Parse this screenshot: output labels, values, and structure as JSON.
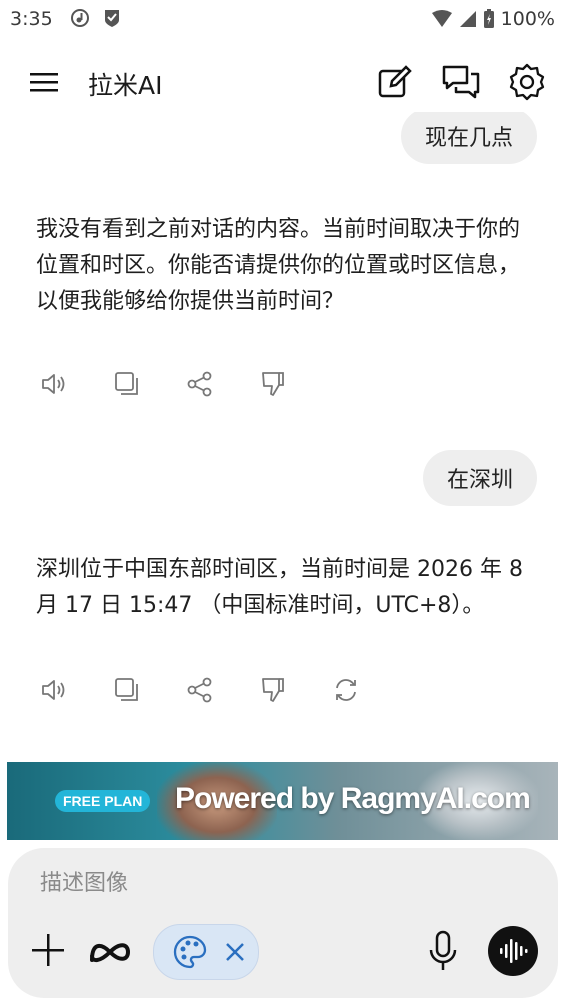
{
  "status": {
    "time": "3:35",
    "battery": "100%"
  },
  "app": {
    "title": "拉米AI"
  },
  "chat": {
    "user_message_1": "现在几点",
    "ai_message_1": "我没有看到之前对话的内容。当前时间取决于你的位置和时区。你能否请提供你的位置或时区信息，以便我能够给你提供当前时间？",
    "user_message_2": "在深圳",
    "ai_message_2": "深圳位于中国东部时间区，当前时间是 2026 年 8 月 17 日 15:47 （中国标准时间，UTC+8）。"
  },
  "banner": {
    "badge": "FREE PLAN",
    "text": "Powered by RagmyAI.com"
  },
  "composer": {
    "placeholder": "描述图像"
  },
  "icons": [
    "menu-icon",
    "edit-icon",
    "chats-icon",
    "settings-icon",
    "speaker-icon",
    "copy-icon",
    "share-icon",
    "thumbs-down-icon",
    "regenerate-icon",
    "plus-icon",
    "meta-icon",
    "palette-icon",
    "close-icon",
    "mic-icon",
    "voice-icon"
  ]
}
